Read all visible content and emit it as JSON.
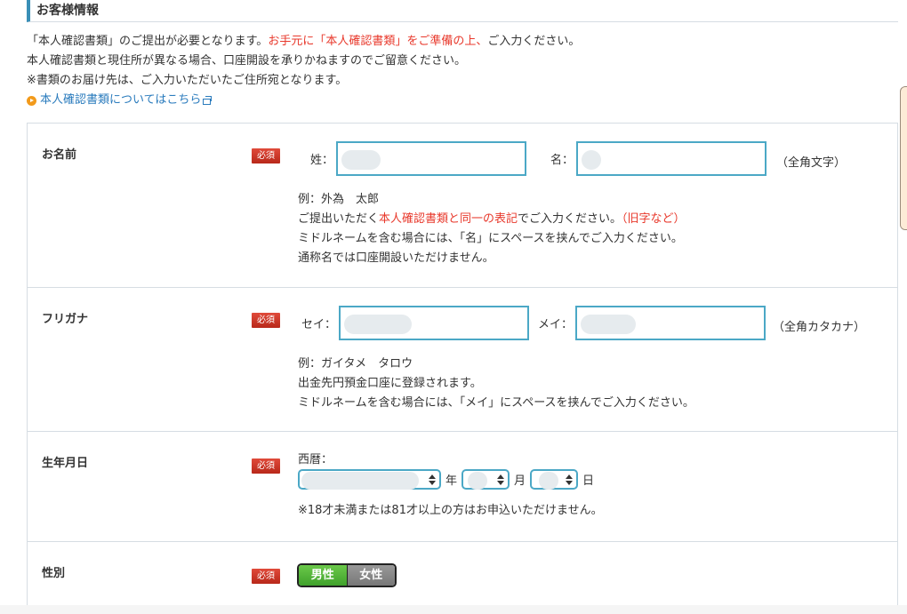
{
  "section": {
    "title": "お客様情報"
  },
  "intro": {
    "line1_a": "「本人確認書類」のご提出が必要となります。",
    "line1_red": "お手元に「本人確認書類」をご準備の上、",
    "line1_b": "ご入力ください。",
    "line2": "本人確認書類と現住所が異なる場合、口座開設を承りかねますのでご留意ください。",
    "line3": "※書類のお届け先は、ご入力いただいたご住所宛となります。",
    "link": "本人確認書類についてはこちら"
  },
  "required_label": "必須",
  "name": {
    "label": "お名前",
    "last_label": "姓：",
    "first_label": "名：",
    "last_value": "",
    "first_value": "",
    "note": "（全角文字）",
    "hint_example": "例：外為　太郎",
    "hint_a": "ご提出いただく",
    "hint_red": "本人確認書類と同一の表記",
    "hint_b": "でご入力ください。",
    "hint_red2": "（旧字など）",
    "hint_middle": "ミドルネームを含む場合には、「名」にスペースを挟んでご入力ください。",
    "hint_alias": "通称名では口座開設いただけません。"
  },
  "furigana": {
    "label": "フリガナ",
    "last_label": "セイ：",
    "first_label": "メイ：",
    "last_value": "",
    "first_value": "",
    "note": "（全角カタカナ）",
    "hint_example": "例：ガイタメ　タロウ",
    "hint_bank": "出金先円預金口座に登録されます。",
    "hint_middle": "ミドルネームを含む場合には、「メイ」にスペースを挟んでご入力ください。"
  },
  "birthdate": {
    "label": "生年月日",
    "era_label": "西暦：",
    "year_suffix": "年",
    "month_suffix": "月",
    "day_suffix": "日",
    "year_value": "",
    "month_value": "",
    "day_value": "",
    "note": "※18才未満または81才以上の方はお申込いただけません。"
  },
  "gender": {
    "label": "性別",
    "options": [
      "男性",
      "女性"
    ],
    "selected": "男性"
  }
}
